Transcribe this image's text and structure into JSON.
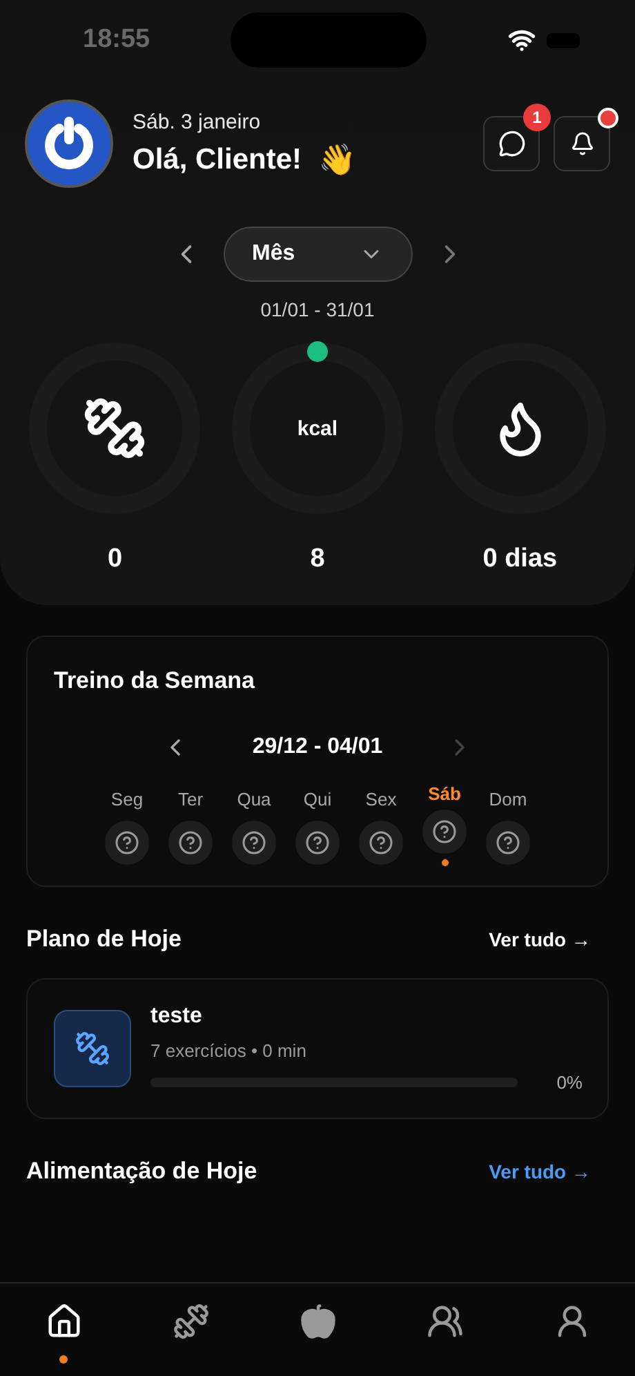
{
  "status_bar": {
    "time": "18:55"
  },
  "header": {
    "date": "Sáb. 3 janeiro",
    "greeting": "Olá, Cliente!",
    "greeting_emoji": "👋",
    "messages_badge": "1",
    "notifications_dot": true
  },
  "period": {
    "value": "Mês",
    "range": "01/01 - 31/01"
  },
  "stats": [
    {
      "kind": "workouts",
      "value": "0"
    },
    {
      "kind": "calories",
      "label": "kcal",
      "value": "8"
    },
    {
      "kind": "streak",
      "value": "0 dias"
    }
  ],
  "week": {
    "title": "Treino da Semana",
    "range": "29/12 - 04/01",
    "days": [
      {
        "label": "Seg",
        "selected": false
      },
      {
        "label": "Ter",
        "selected": false
      },
      {
        "label": "Qua",
        "selected": false
      },
      {
        "label": "Qui",
        "selected": false
      },
      {
        "label": "Sex",
        "selected": false
      },
      {
        "label": "Sáb",
        "selected": true
      },
      {
        "label": "Dom",
        "selected": false
      }
    ]
  },
  "today_plan": {
    "title": "Plano de Hoje",
    "link": "Ver tudo →",
    "workout": {
      "name": "teste",
      "details": "7 exercícios • 0 min",
      "percent": "0%"
    }
  },
  "today_food": {
    "title": "Alimentação de Hoje",
    "link": "Ver tudo →"
  },
  "tab_bar": [
    {
      "kind": "home",
      "selected": true
    },
    {
      "kind": "workouts",
      "selected": false
    },
    {
      "kind": "nutrition",
      "selected": false
    },
    {
      "kind": "community",
      "selected": false
    },
    {
      "kind": "profile",
      "selected": false
    }
  ]
}
